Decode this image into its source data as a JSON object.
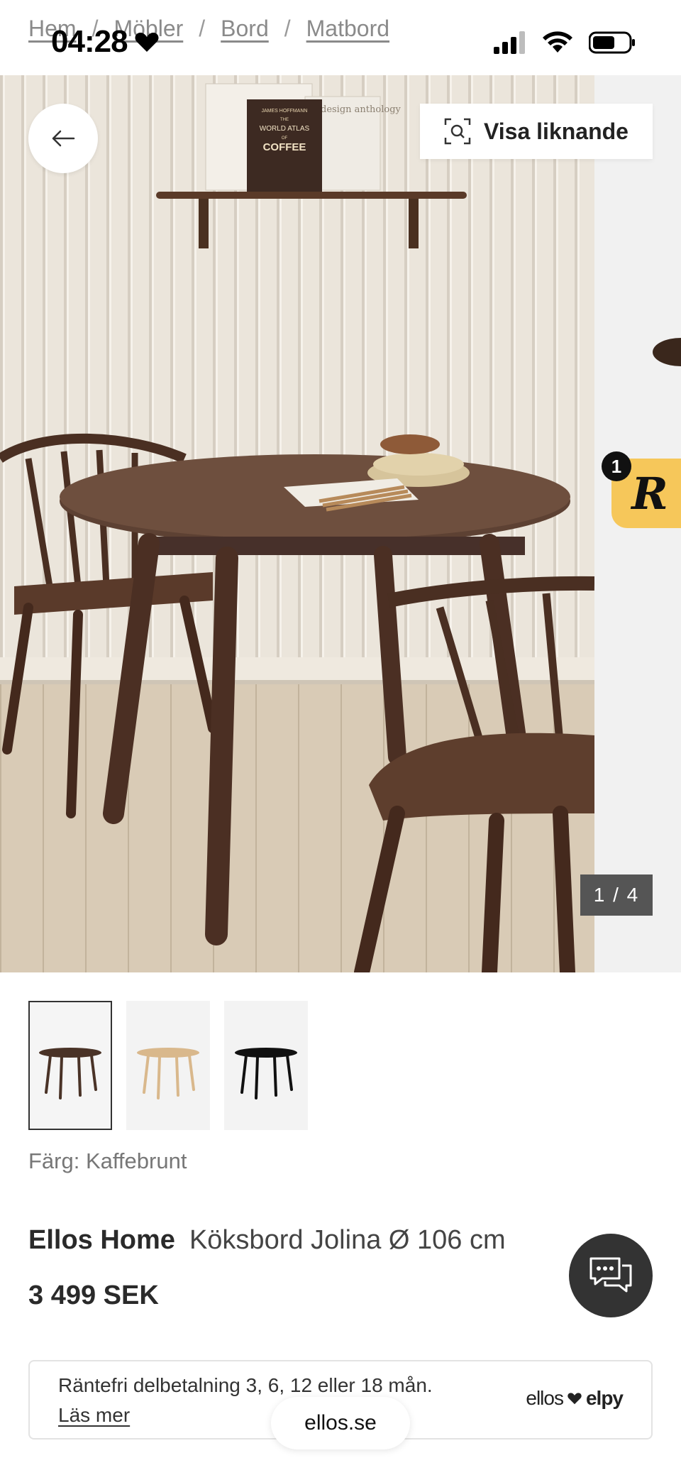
{
  "breadcrumb": {
    "items": [
      {
        "label": "Hem"
      },
      {
        "label": "Möbler"
      },
      {
        "label": "Bord"
      },
      {
        "label": "Matbord"
      }
    ],
    "separator": "/"
  },
  "status_bar": {
    "time": "04:28",
    "heart_icon": "heart-icon",
    "signal_icon": "signal-icon",
    "wifi_icon": "wifi-icon",
    "battery_icon": "battery-icon"
  },
  "gallery": {
    "back_icon": "arrow-left-icon",
    "similar_button_label": "Visa liknande",
    "similar_icon": "visual-search-icon",
    "counter": "1 / 4",
    "current_index": 1,
    "total": 4,
    "book_text": {
      "author": "JAMES HOFFMANN",
      "the": "THE",
      "title_line1": "WORLD ATLAS",
      "of": "OF",
      "title_line2": "COFFEE",
      "second_book": "design anthology"
    },
    "review_badge": {
      "letter": "R",
      "count": "1"
    }
  },
  "thumbnails": [
    {
      "name": "kaffebrunt",
      "color": "#4a3327",
      "active": true
    },
    {
      "name": "natur",
      "color": "#d9b88c",
      "active": false
    },
    {
      "name": "svart",
      "color": "#111111",
      "active": false
    }
  ],
  "product": {
    "color_label": "Färg: Kaffebrunt",
    "brand": "Ellos Home",
    "name": "Köksbord Jolina Ø 106 cm",
    "price": "3 499 SEK"
  },
  "chat": {
    "icon": "chat-bubbles-icon"
  },
  "payment": {
    "text": "Räntefri delbetalning 3, 6, 12 eller 18 mån.",
    "link": "Läs mer",
    "logo_left": "ellos",
    "logo_right": "elpy"
  },
  "browser": {
    "domain": "ellos.se"
  },
  "colors": {
    "accent_yellow": "#f6c75a",
    "counter_bg": "#555555",
    "chat_bg": "#333333"
  }
}
